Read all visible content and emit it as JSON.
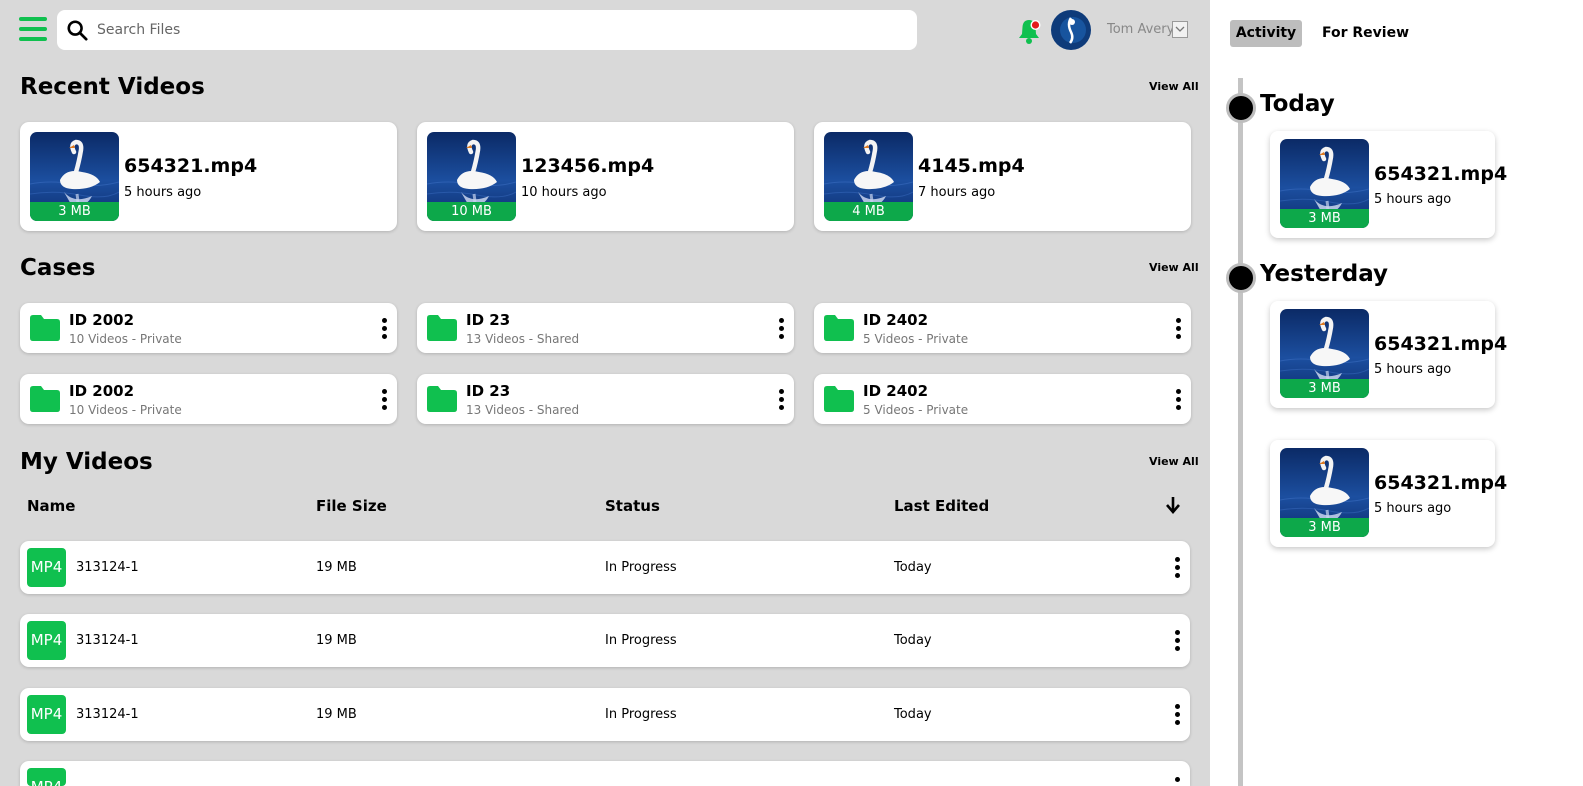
{
  "search": {
    "placeholder": "Search Files"
  },
  "user": {
    "name": "Tom Avery"
  },
  "colors": {
    "accent": "#10c04f",
    "accent_dark": "#0da84a",
    "background": "#d9d9d9",
    "notification_dot": "#e31b1b"
  },
  "recent_videos": {
    "title": "Recent Videos",
    "view_all": "View All",
    "items": [
      {
        "name": "654321.mp4",
        "time": "5 hours ago",
        "size": "3 MB"
      },
      {
        "name": "123456.mp4",
        "time": "10 hours ago",
        "size": "10 MB"
      },
      {
        "name": "4145.mp4",
        "time": "7 hours ago",
        "size": "4 MB"
      }
    ]
  },
  "cases": {
    "title": "Cases",
    "view_all": "View All",
    "items": [
      {
        "name": "ID 2002",
        "meta": "10 Videos - Private"
      },
      {
        "name": "ID 23",
        "meta": "13 Videos - Shared"
      },
      {
        "name": "ID 2402",
        "meta": "5 Videos - Private"
      },
      {
        "name": "ID 2002",
        "meta": "10 Videos - Private"
      },
      {
        "name": "ID 23",
        "meta": "13 Videos - Shared"
      },
      {
        "name": "ID 2402",
        "meta": "5 Videos - Private"
      }
    ]
  },
  "my_videos": {
    "title": "My Videos",
    "view_all": "View All",
    "columns": [
      "Name",
      "File Size",
      "Status",
      "Last Edited"
    ],
    "rows": [
      {
        "type": "MP4",
        "name": "313124-1",
        "size": "19 MB",
        "status": "In Progress",
        "edited": "Today"
      },
      {
        "type": "MP4",
        "name": "313124-1",
        "size": "19 MB",
        "status": "In Progress",
        "edited": "Today"
      },
      {
        "type": "MP4",
        "name": "313124-1",
        "size": "19 MB",
        "status": "In Progress",
        "edited": "Today"
      },
      {
        "type": "MP4",
        "name": "",
        "size": "",
        "status": "",
        "edited": ""
      }
    ]
  },
  "panel": {
    "tabs": [
      "Activity",
      "For Review"
    ],
    "groups": [
      {
        "label": "Today",
        "items": [
          {
            "name": "654321.mp4",
            "time": "5 hours ago",
            "size": "3 MB"
          }
        ]
      },
      {
        "label": "Yesterday",
        "items": [
          {
            "name": "654321.mp4",
            "time": "5 hours ago",
            "size": "3 MB"
          },
          {
            "name": "654321.mp4",
            "time": "5 hours ago",
            "size": "3 MB"
          }
        ]
      }
    ]
  }
}
